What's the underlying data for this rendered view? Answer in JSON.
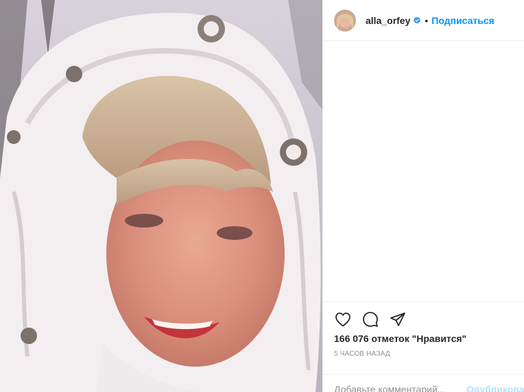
{
  "header": {
    "username": "alla_orfey",
    "separator": "•",
    "follow_label": "Подписаться"
  },
  "post": {
    "likes_text": "166 076 отметок \"Нравится\"",
    "time_ago": "5 часов назад"
  },
  "comment": {
    "placeholder": "Добавьте комментарий...",
    "publish_label": "Опубликовать"
  },
  "icons": {
    "like": "heart-icon",
    "comment": "comment-icon",
    "share": "paper-plane-icon",
    "verified": "verified-badge-icon"
  },
  "colors": {
    "accent": "#0095f6",
    "publish_disabled": "#b2dffc",
    "text": "#262626",
    "muted": "#8e8e8e",
    "divider": "#efefef"
  }
}
